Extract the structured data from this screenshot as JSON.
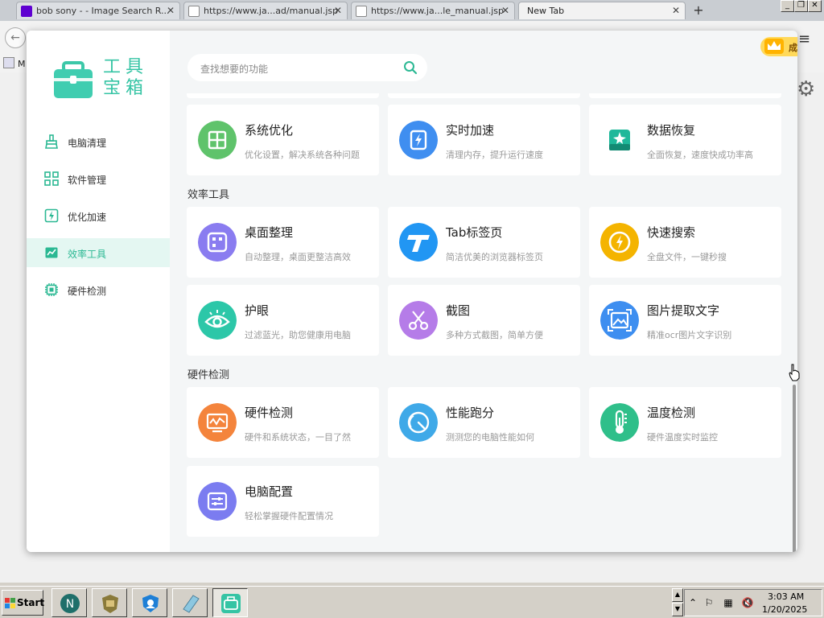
{
  "browser": {
    "tabs": [
      {
        "label": "bob sony - - Image Search R...",
        "icon": "yahoo-icon",
        "color": "#5f01d1"
      },
      {
        "label": "https://www.ja...ad/manual.jsp",
        "icon": "document-icon",
        "color": "#888888"
      },
      {
        "label": "https://www.ja...le_manual.jsp",
        "icon": "document-icon",
        "color": "#888888"
      },
      {
        "label": "New Tab",
        "icon": "",
        "color": ""
      }
    ],
    "close_glyph": "✕",
    "new_tab_glyph": "+",
    "bookmark_text": "M"
  },
  "app": {
    "logo_text": [
      "工具",
      "宝箱"
    ],
    "nav": [
      {
        "label": "电脑清理",
        "icon": "broom-icon"
      },
      {
        "label": "软件管理",
        "icon": "grid-apps-icon"
      },
      {
        "label": "优化加速",
        "icon": "bolt-icon"
      },
      {
        "label": "效率工具",
        "icon": "chart-icon",
        "active": true
      },
      {
        "label": "硬件检测",
        "icon": "chip-icon"
      }
    ],
    "search_placeholder": "查找想要的功能",
    "vip_label": "成为会员",
    "window_controls": {
      "menu": "☰",
      "minimize": "—",
      "close": "✕"
    },
    "sections": [
      {
        "title": "",
        "cards": [
          {
            "title": "系统优化",
            "desc": "优化设置，解决系统各种问题",
            "icon": "windows-icon",
            "color": "#5fc36b"
          },
          {
            "title": "实时加速",
            "desc": "清理内存，提升运行速度",
            "icon": "lightning-icon",
            "color": "#3f8ef0"
          },
          {
            "title": "数据恢复",
            "desc": "全面恢复，速度快成功率高",
            "icon": "disk-icon",
            "color": "#1fb89a"
          }
        ]
      },
      {
        "title": "效率工具",
        "cards": [
          {
            "title": "桌面整理",
            "desc": "自动整理，桌面更整洁高效",
            "icon": "desktop-grid-icon",
            "color": "#8a7cf0"
          },
          {
            "title": "Tab标签页",
            "desc": "简洁优美的浏览器标签页",
            "icon": "tab-t-icon",
            "color": "#2196f3"
          },
          {
            "title": "快速搜索",
            "desc": "全盘文件，一键秒搜",
            "icon": "search-bolt-icon",
            "color": "#f4b400"
          },
          {
            "title": "护眼",
            "desc": "过滤蓝光，助您健康用电脑",
            "icon": "eye-icon",
            "color": "#2cc7a8"
          },
          {
            "title": "截图",
            "desc": "多种方式截图，简单方便",
            "icon": "scissors-icon",
            "color": "#b57ce8"
          },
          {
            "title": "图片提取文字",
            "desc": "精准ocr图片文字识别",
            "icon": "image-ocr-icon",
            "color": "#3d8ef0"
          }
        ]
      },
      {
        "title": "硬件检测",
        "cards": [
          {
            "title": "硬件检测",
            "desc": "硬件和系统状态，一目了然",
            "icon": "monitor-wave-icon",
            "color": "#f4843c"
          },
          {
            "title": "性能跑分",
            "desc": "测测您的电脑性能如何",
            "icon": "gauge-icon",
            "color": "#3fa9e8"
          },
          {
            "title": "温度检测",
            "desc": "硬件温度实时监控",
            "icon": "thermometer-icon",
            "color": "#2fbf8a"
          },
          {
            "title": "电脑配置",
            "desc": "轻松掌握硬件配置情况",
            "icon": "sliders-icon",
            "color": "#7b7cf0"
          }
        ]
      }
    ]
  },
  "taskbar": {
    "start_label": "Start",
    "time": "3:03 AM",
    "date": "1/20/2025",
    "buttons": [
      "netscape-icon",
      "firewall-shield-icon",
      "security-shield-icon",
      "notepad-icon",
      "toolbox-icon"
    ]
  },
  "colors": {
    "accent": "#2bb893",
    "vip": "#ffd95a"
  }
}
